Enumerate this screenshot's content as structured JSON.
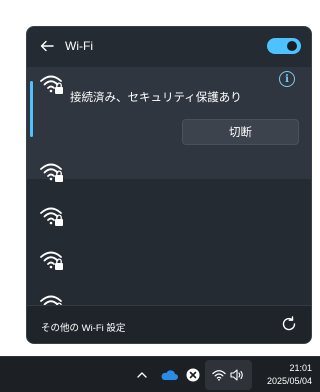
{
  "wifi_panel": {
    "title": "Wi-Fi",
    "wifi_enabled": true,
    "connected_network": {
      "status": "接続済み、セキュリティ保護あり",
      "disconnect_label": "切断"
    },
    "other_networks_visible": 4,
    "footer": {
      "settings_label": "その他の Wi-Fi 設定"
    }
  },
  "taskbar": {
    "time": "21:01",
    "date": "2025/05/04"
  },
  "colors": {
    "accent": "#4cc2ff",
    "panel_bg": "#252b33",
    "connected_bg": "#30363f",
    "taskbar_bg": "#1c1f24"
  },
  "icons": [
    "back-arrow-icon",
    "wifi-secured-icon",
    "info-icon",
    "refresh-icon",
    "chevron-up-icon",
    "onedrive-cloud-icon",
    "close-circle-icon",
    "wifi-icon",
    "speaker-icon"
  ]
}
